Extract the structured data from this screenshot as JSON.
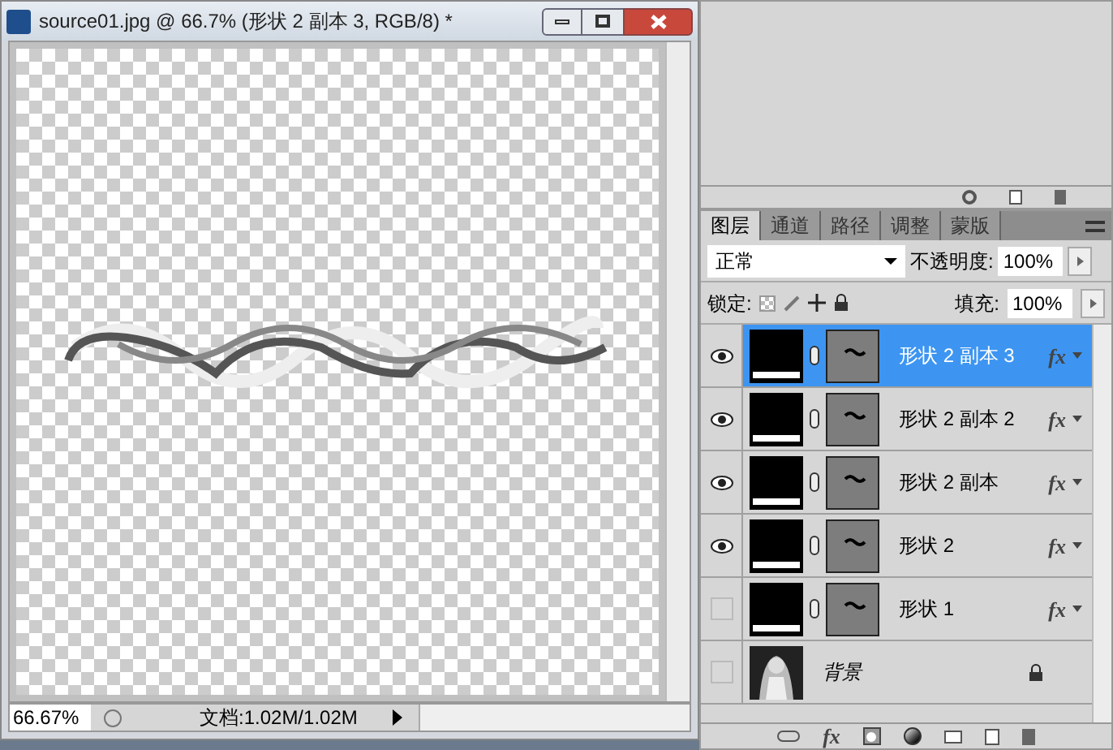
{
  "document": {
    "title": "source01.jpg @ 66.7% (形状 2 副本 3, RGB/8) *",
    "zoom": "66.67%",
    "doc_info": "文档:1.02M/1.02M"
  },
  "layers_panel": {
    "tabs": [
      {
        "label": "图层",
        "selected": true
      },
      {
        "label": "通道",
        "selected": false
      },
      {
        "label": "路径",
        "selected": false
      },
      {
        "label": "调整",
        "selected": false
      },
      {
        "label": "蒙版",
        "selected": false
      }
    ],
    "blend_mode": "正常",
    "opacity_label": "不透明度:",
    "opacity": "100%",
    "lock_label": "锁定:",
    "fill_label": "填充:",
    "fill": "100%",
    "layers": [
      {
        "name": "形状 2 副本 3",
        "kind": "shape",
        "visible": true,
        "selected": true,
        "effects": "fx",
        "locked": false
      },
      {
        "name": "形状 2 副本 2",
        "kind": "shape",
        "visible": true,
        "selected": false,
        "effects": "fx",
        "locked": false
      },
      {
        "name": "形状 2 副本",
        "kind": "shape",
        "visible": true,
        "selected": false,
        "effects": "fx",
        "locked": false
      },
      {
        "name": "形状 2",
        "kind": "shape",
        "visible": true,
        "selected": false,
        "effects": "fx",
        "locked": false
      },
      {
        "name": "形状 1",
        "kind": "shape",
        "visible": false,
        "selected": false,
        "effects": "fx",
        "locked": false
      },
      {
        "name": "背景",
        "kind": "background",
        "visible": false,
        "selected": false,
        "locked": true
      }
    ],
    "add_style_button": "fx"
  }
}
